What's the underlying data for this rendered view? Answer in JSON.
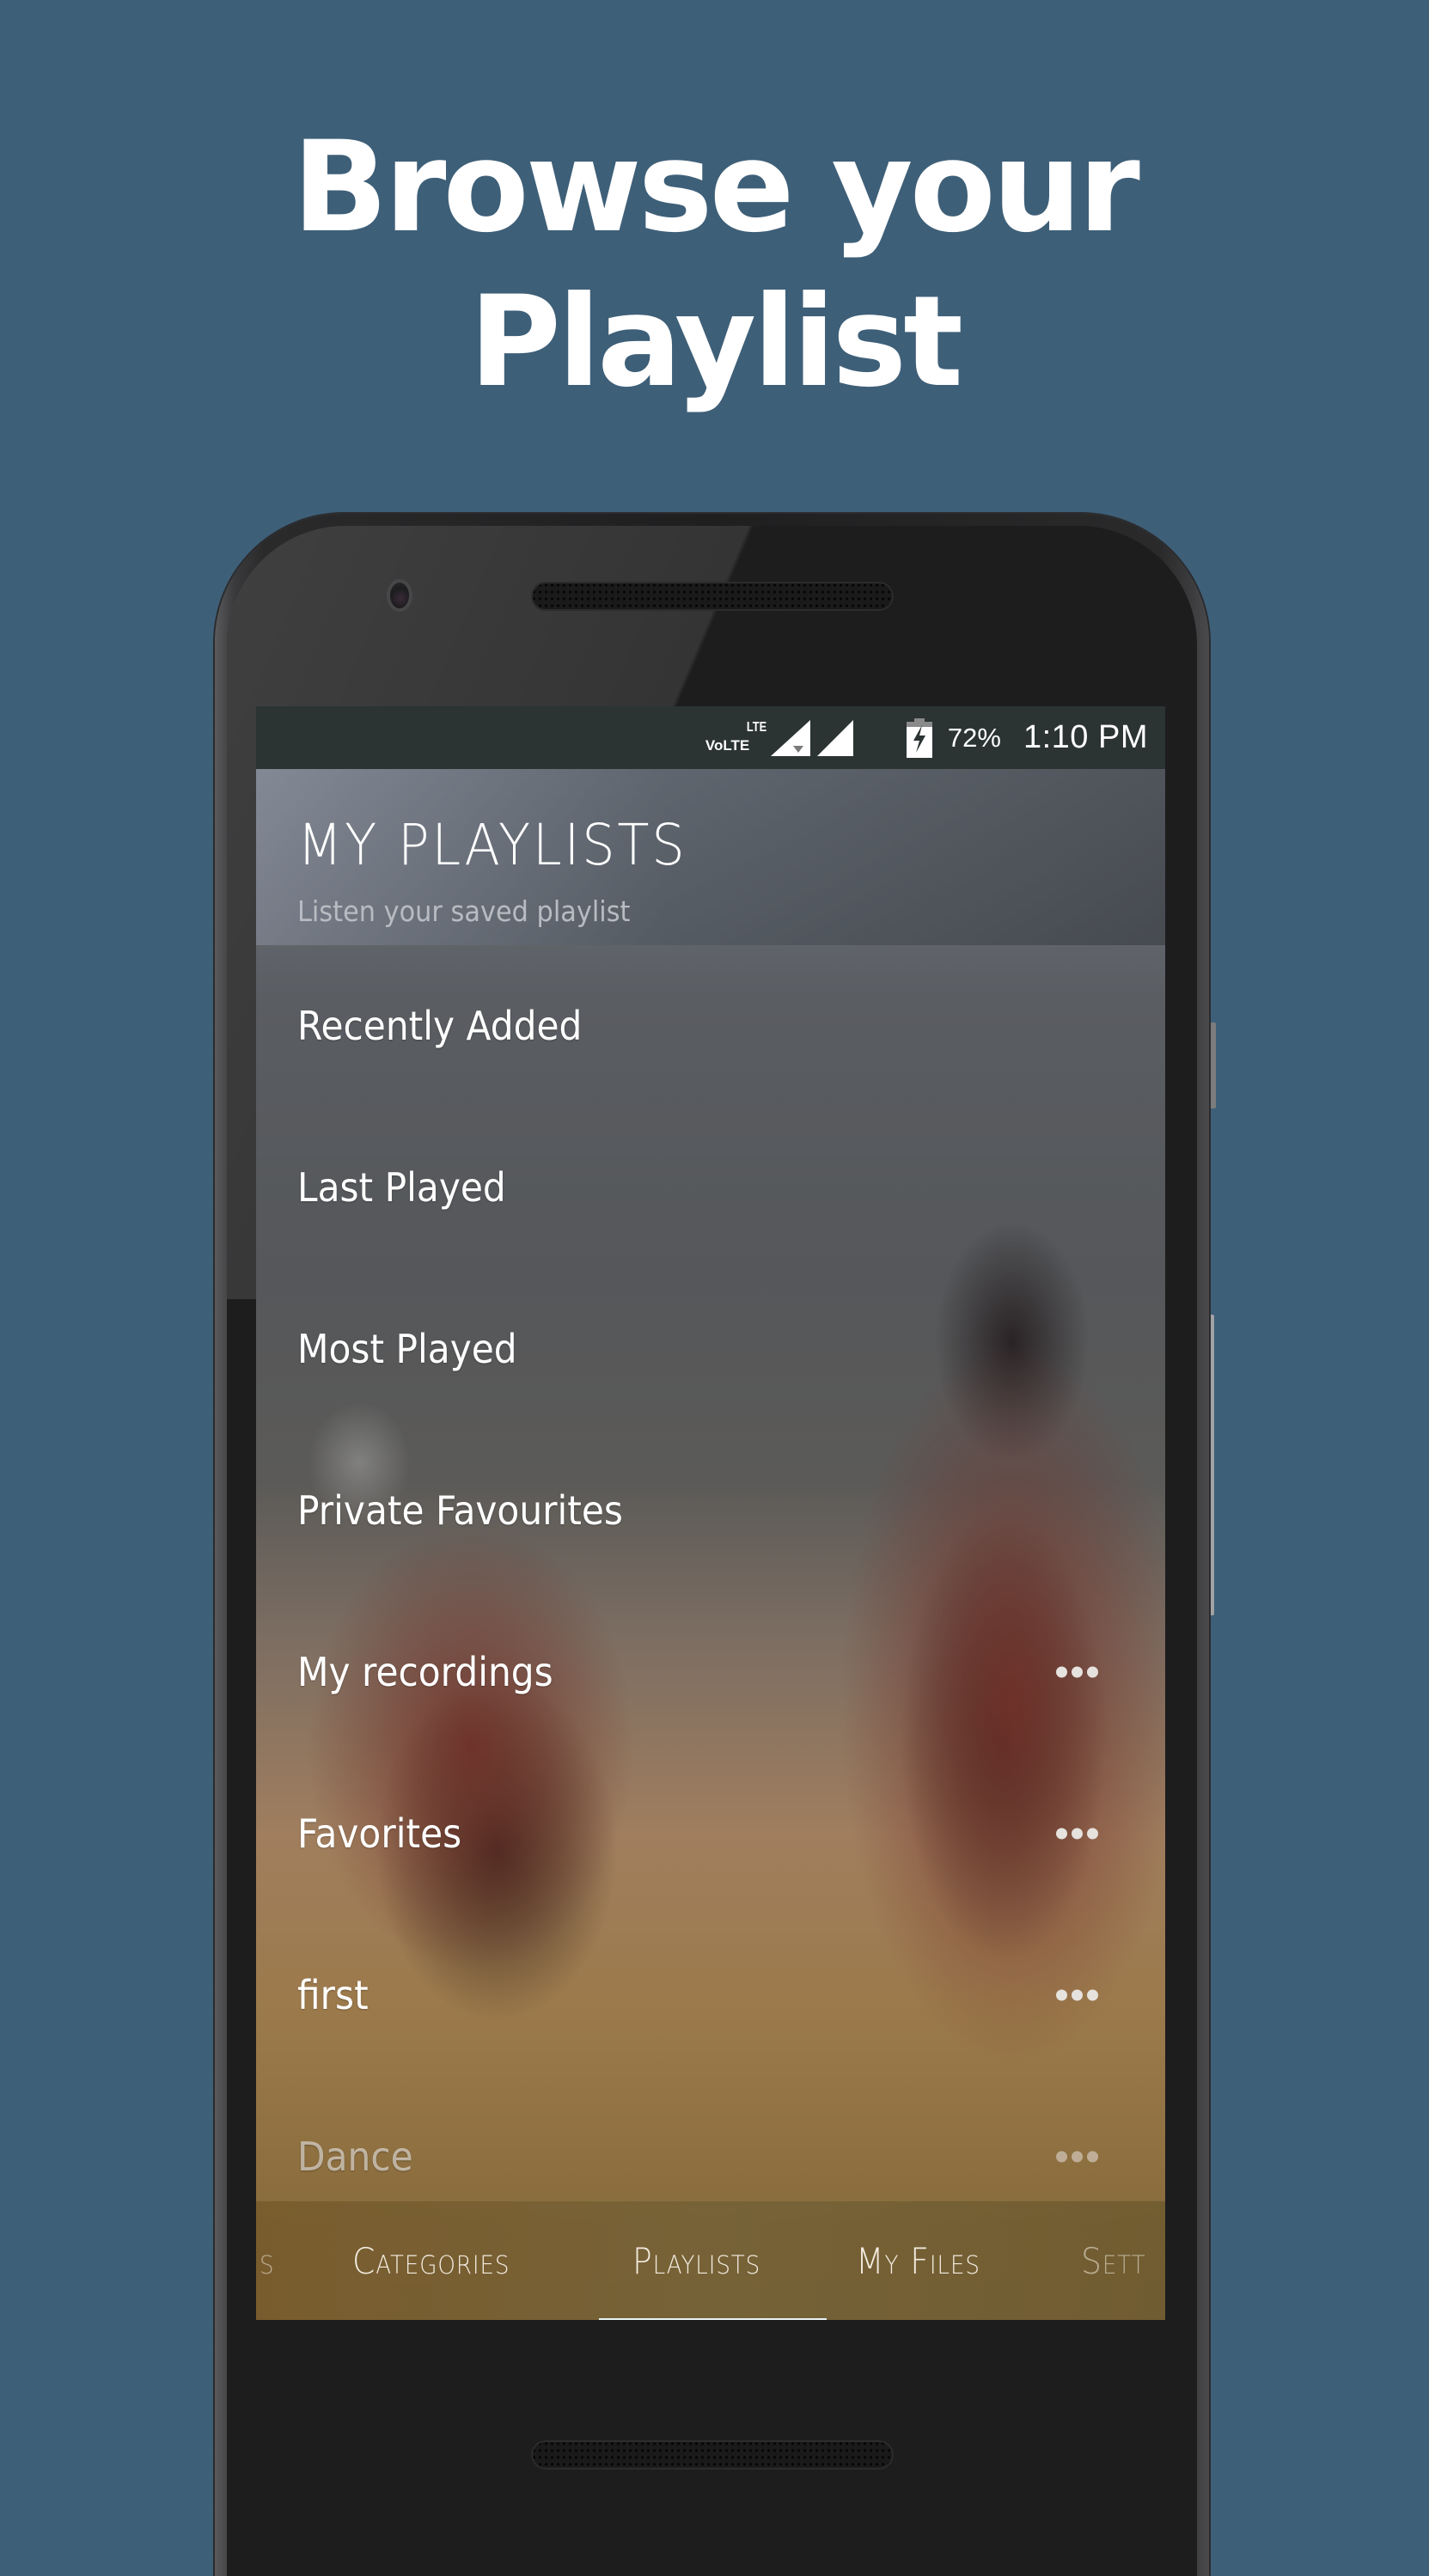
{
  "headline": {
    "line1": "Browse your",
    "line2": "Playlist"
  },
  "status_bar": {
    "volte_label": "VoLTE",
    "lte_label": "LTE",
    "icons": [
      "volte-icon",
      "lte-signal-icon",
      "signal-icon",
      "battery-charging-icon"
    ],
    "battery_percent": "72%",
    "time": "1:10 PM"
  },
  "header": {
    "title": "MY PLAYLISTS",
    "subtitle": "Listen your saved playlist"
  },
  "playlists": [
    {
      "label": "Recently Added",
      "has_menu": false
    },
    {
      "label": "Last Played",
      "has_menu": false
    },
    {
      "label": "Most Played",
      "has_menu": false
    },
    {
      "label": "Private Favourites",
      "has_menu": false
    },
    {
      "label": "My recordings",
      "has_menu": true
    },
    {
      "label": "Favorites",
      "has_menu": true
    },
    {
      "label": "first",
      "has_menu": true
    },
    {
      "label": "Dance",
      "has_menu": true
    }
  ],
  "tabs": [
    {
      "label": "s",
      "partial": true
    },
    {
      "label": "Categories",
      "partial": false
    },
    {
      "label": "Playlists",
      "partial": false,
      "active": true
    },
    {
      "label": "My Files",
      "partial": false
    },
    {
      "label": "Sett",
      "partial": true
    }
  ],
  "colors": {
    "background": "#3e5f78",
    "status_bar": "#2b3333",
    "tab_bar": "#76603a",
    "tab_indicator": "#e8f4f4"
  }
}
